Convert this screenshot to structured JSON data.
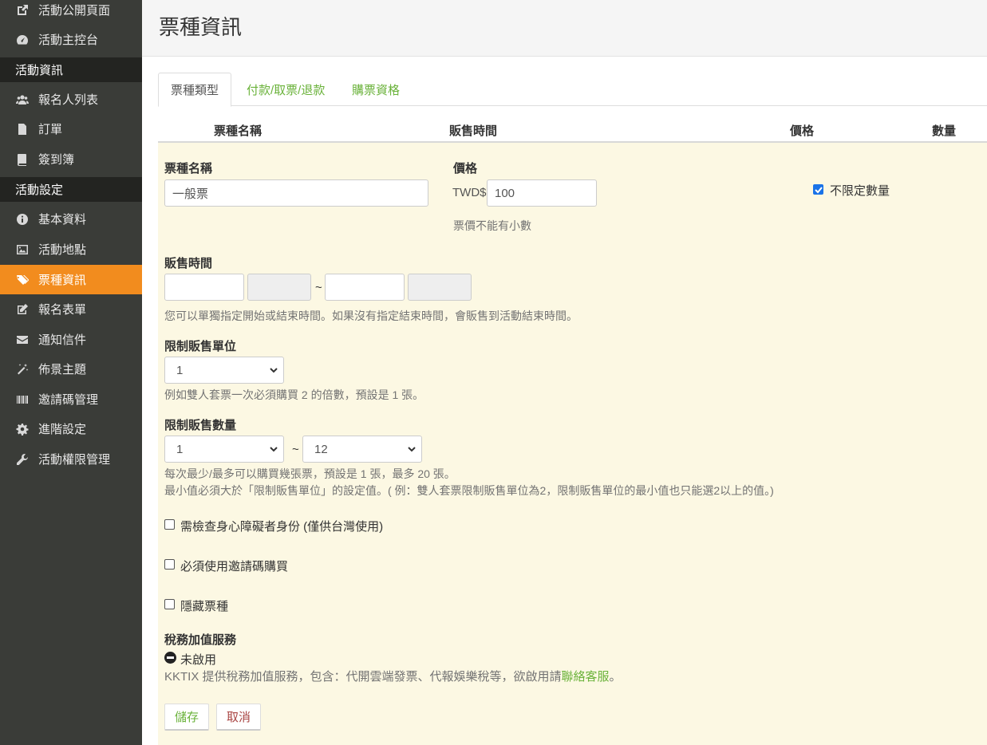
{
  "sidebar": {
    "items": [
      {
        "label": "活動公開頁面",
        "icon": "external-link-icon"
      },
      {
        "label": "活動主控台",
        "icon": "dashboard-icon"
      }
    ],
    "section_info": "活動資訊",
    "info_items": [
      {
        "label": "報名人列表",
        "icon": "users-icon"
      },
      {
        "label": "訂單",
        "icon": "file-icon"
      },
      {
        "label": "簽到簿",
        "icon": "book-icon"
      }
    ],
    "section_settings": "活動設定",
    "settings_items": [
      {
        "label": "基本資料",
        "icon": "info-circle-icon"
      },
      {
        "label": "活動地點",
        "icon": "image-icon"
      },
      {
        "label": "票種資訊",
        "icon": "tags-icon",
        "active": true
      },
      {
        "label": "報名表單",
        "icon": "edit-icon"
      },
      {
        "label": "通知信件",
        "icon": "envelope-icon"
      },
      {
        "label": "佈景主題",
        "icon": "magic-wand-icon"
      },
      {
        "label": "邀請碼管理",
        "icon": "barcode-icon"
      },
      {
        "label": "進階設定",
        "icon": "gear-icon"
      },
      {
        "label": "活動權限管理",
        "icon": "wrench-icon"
      }
    ]
  },
  "header": {
    "title": "票種資訊"
  },
  "tabs": [
    {
      "label": "票種類型",
      "active": true
    },
    {
      "label": "付款/取票/退款"
    },
    {
      "label": "購票資格"
    }
  ],
  "columns": [
    "票種名稱",
    "販售時間",
    "價格",
    "數量"
  ],
  "form": {
    "name_label": "票種名稱",
    "name_value": "一般票",
    "price_label": "價格",
    "currency": "TWD$",
    "price_value": "100",
    "price_help": "票價不能有小數",
    "unlimited_label": "不限定數量",
    "unlimited_checked": true,
    "sale_time_label": "販售時間",
    "sale_time_tilde": "~",
    "sale_time_help": "您可以單獨指定開始或結束時間。如果沒有指定結束時間，會販售到活動結束時間。",
    "unit_label": "限制販售單位",
    "unit_value": "1",
    "unit_help": "例如雙人套票一次必須購買 2 的倍數，預設是 1 張。",
    "qty_label": "限制販售數量",
    "qty_min": "1",
    "qty_tilde": "~",
    "qty_max": "12",
    "qty_help_1": "每次最少/最多可以購買幾張票，預設是 1 張，最多 20 張。",
    "qty_help_2": "最小值必須大於「限制販售單位」的設定值。( 例：雙人套票限制販售單位為2，限制販售單位的最小值也只能選2以上的值。)",
    "disability_label": "需檢查身心障礙者身份 (僅供台灣使用)",
    "invite_label": "必須使用邀請碼購買",
    "hidden_label": "隱藏票種",
    "tax_label": "稅務加值服務",
    "tax_status": "未啟用",
    "tax_help_prefix": "KKTIX 提供稅務加值服務，包含：代開雲端發票、代報娛樂稅等，欲啟用請",
    "tax_help_link": "聯絡客服",
    "tax_help_suffix": "。",
    "save_label": "儲存",
    "cancel_label": "取消"
  },
  "colors": {
    "sidebar_bg": "#3a3c38",
    "sidebar_section_bg": "#232421",
    "active_bg": "#f28c1e",
    "link_green": "#6ab23a",
    "panel_bg": "#fcf8e3",
    "cancel_red": "#a94442"
  }
}
